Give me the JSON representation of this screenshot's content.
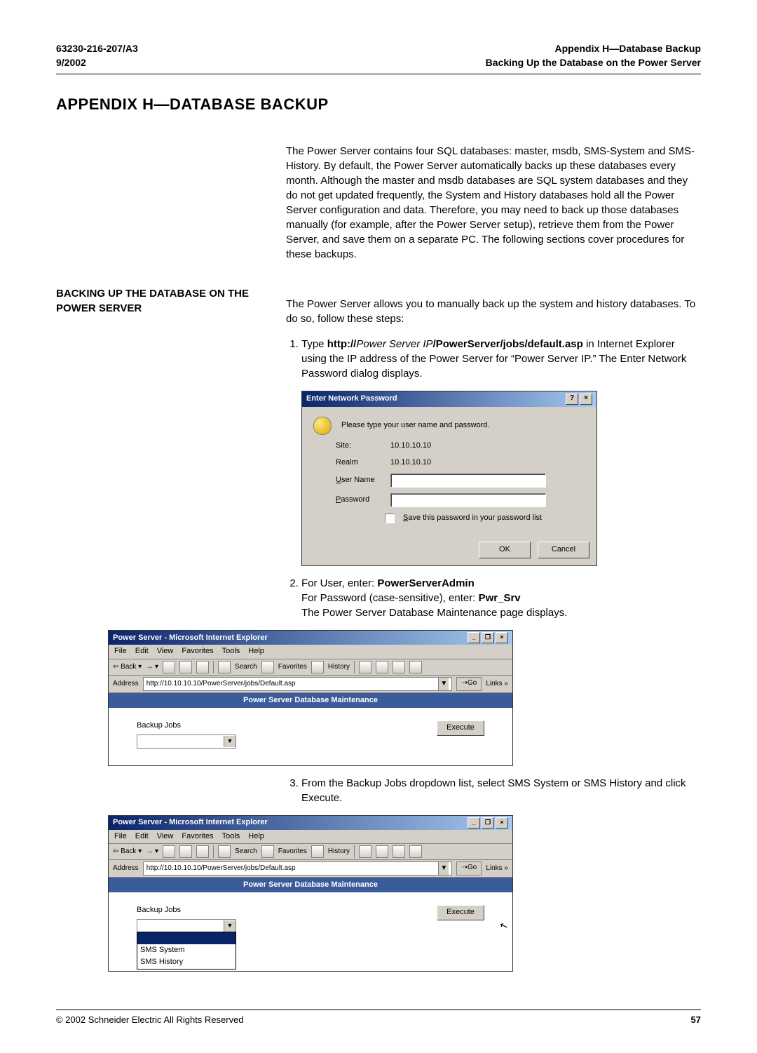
{
  "header": {
    "left_line1": "63230-216-207/A3",
    "left_line2": "9/2002",
    "right_line1": "Appendix H—Database Backup",
    "right_line2": "Backing Up the Database on the Power Server"
  },
  "title": "APPENDIX H—DATABASE BACKUP",
  "intro": "The Power Server contains four SQL databases: master, msdb, SMS-System and SMS-History. By default, the Power Server automatically backs up these databases every month. Although the master and msdb databases are SQL system databases and they do not get updated frequently, the System and History databases hold all the Power Server configuration and data. Therefore, you may need to back up those databases manually (for example, after the Power Server setup), retrieve them from the Power Server, and save them on a separate PC. The following sections cover procedures for these backups.",
  "section_title": "BACKING UP THE DATABASE ON THE POWER SERVER",
  "section_lead": "The Power Server allows you to manually back up the system and history databases. To do so, follow these steps:",
  "step1": {
    "pre": "Type ",
    "scheme": "http://",
    "ip_placeholder": "Power Server IP",
    "path": "/PowerServer/jobs/default.asp",
    "post": " in Internet Explorer using the IP address of the Power Server for “Power Server IP.” The Enter Network Password dialog displays."
  },
  "enp": {
    "title": "Enter Network Password",
    "help_btn": "?",
    "close_btn": "×",
    "prompt": "Please type your user name and password.",
    "site_label": "Site:",
    "site_value": "10.10.10.10",
    "realm_label": "Realm",
    "realm_value": "10.10.10.10",
    "user_label": "User Name",
    "password_label": "Password",
    "save_label": "Save this password in your password list",
    "ok": "OK",
    "cancel": "Cancel"
  },
  "step2": {
    "line1_pre": "For User, enter: ",
    "user_value": "PowerServerAdmin",
    "line2_pre": "For Password (case-sensitive), enter: ",
    "pwd_value": "Pwr_Srv",
    "line3": "The Power Server Database Maintenance page displays."
  },
  "ie": {
    "title": "Power Server - Microsoft Internet Explorer",
    "min": "_",
    "max": "❐",
    "close": "×",
    "menu": [
      "File",
      "Edit",
      "View",
      "Favorites",
      "Tools",
      "Help"
    ],
    "back": "Back",
    "search": "Search",
    "favorites": "Favorites",
    "history": "History",
    "addr_label": "Address",
    "addr_value": "http://10.10.10.10/PowerServer/jobs/Default.asp",
    "go": "Go",
    "links": "Links »",
    "banner": "Power Server Database Maintenance",
    "jobs_label": "Backup Jobs",
    "execute": "Execute",
    "options": [
      "SMS System",
      "SMS History"
    ]
  },
  "step3": "From the Backup Jobs dropdown list, select SMS System or SMS History and click Execute.",
  "footer": {
    "copyright": "© 2002 Schneider Electric  All Rights Reserved",
    "page": "57"
  }
}
